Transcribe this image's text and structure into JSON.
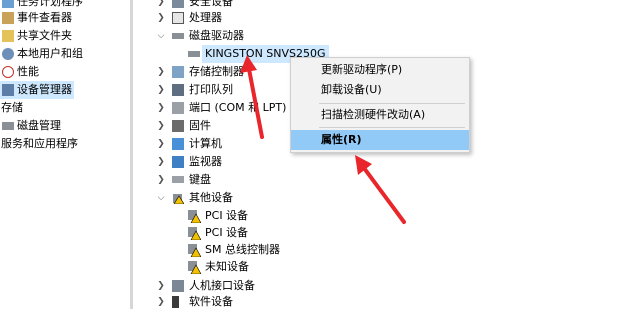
{
  "left_panel": {
    "items": [
      {
        "label": "任务计划程序"
      },
      {
        "label": "事件查看器"
      },
      {
        "label": "共享文件夹"
      },
      {
        "label": "本地用户和组"
      },
      {
        "label": "性能"
      },
      {
        "label": "设备管理器"
      },
      {
        "label": "存储"
      },
      {
        "label": "磁盘管理"
      },
      {
        "label": "服务和应用程序"
      }
    ]
  },
  "tree": {
    "items": [
      {
        "label": "安全设备"
      },
      {
        "label": "处理器"
      },
      {
        "label": "磁盘驱动器"
      },
      {
        "label": "KINGSTON SNVS250G"
      },
      {
        "label": "存储控制器"
      },
      {
        "label": "打印队列"
      },
      {
        "label": "端口 (COM 和 LPT)"
      },
      {
        "label": "固件"
      },
      {
        "label": "计算机"
      },
      {
        "label": "监视器"
      },
      {
        "label": "键盘"
      },
      {
        "label": "其他设备"
      },
      {
        "label": "PCI 设备"
      },
      {
        "label": "PCI 设备"
      },
      {
        "label": "SM 总线控制器"
      },
      {
        "label": "未知设备"
      },
      {
        "label": "人机接口设备"
      },
      {
        "label": "软件设备"
      }
    ]
  },
  "context_menu": {
    "items": [
      {
        "label": "更新驱动程序(P)"
      },
      {
        "label": "卸载设备(U)"
      },
      {
        "label": "扫描检测硬件改动(A)"
      },
      {
        "label": "属性(R)"
      }
    ]
  },
  "colors": {
    "annotation_arrow": "#e8262b",
    "menu_highlight": "#91c9f7",
    "selection": "#cde8ff"
  }
}
